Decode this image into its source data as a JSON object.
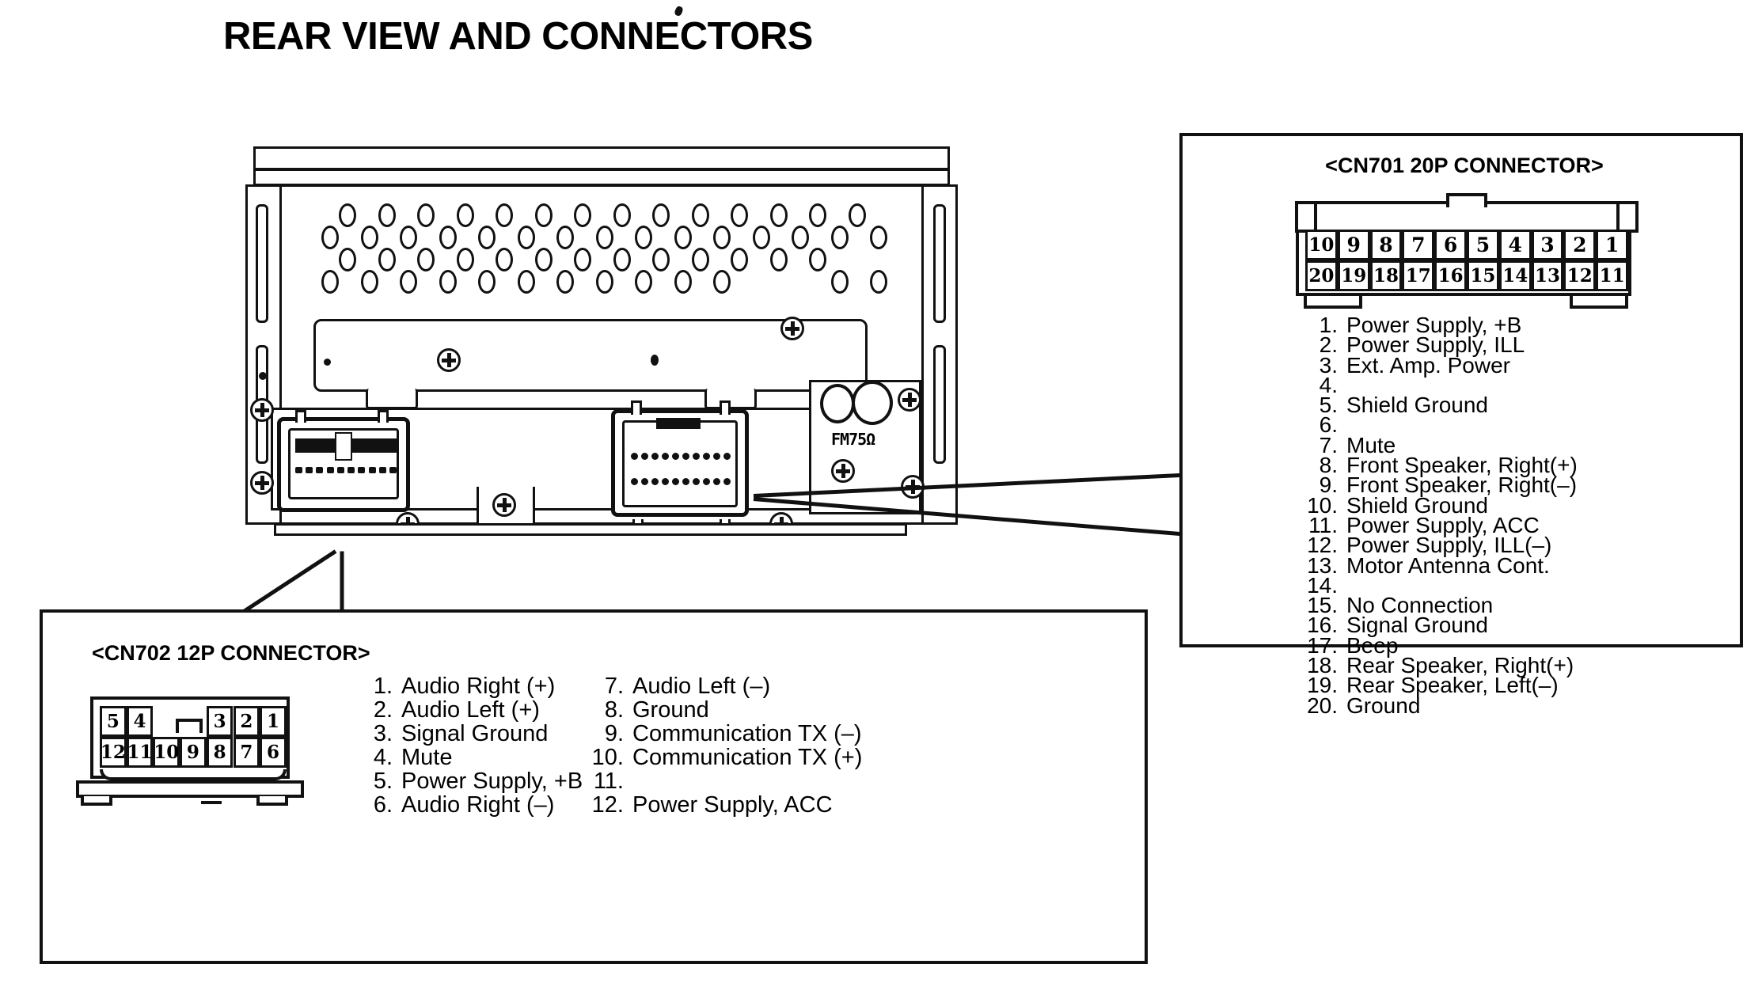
{
  "page": {
    "title": "REAR VIEW AND CONNECTORS"
  },
  "chassis": {
    "antenna_label": "FM75Ω",
    "socket_12p_name": "CN702 12P socket",
    "socket_20p_name": "CN701 20P socket"
  },
  "cn701": {
    "title": "<CN701 20P CONNECTOR>",
    "pin_grid": {
      "top_row": [
        "10",
        "9",
        "8",
        "7",
        "6",
        "5",
        "4",
        "3",
        "2",
        "1"
      ],
      "bottom_row": [
        "20",
        "19",
        "18",
        "17",
        "16",
        "15",
        "14",
        "13",
        "12",
        "11"
      ]
    },
    "pins": [
      {
        "num": "1.",
        "label": "Power Supply, +B"
      },
      {
        "num": "2.",
        "label": "Power Supply, ILL"
      },
      {
        "num": "3.",
        "label": "Ext. Amp. Power"
      },
      {
        "num": "4.",
        "label": ""
      },
      {
        "num": "5.",
        "label": "Shield Ground"
      },
      {
        "num": "6.",
        "label": ""
      },
      {
        "num": "7.",
        "label": "Mute"
      },
      {
        "num": "8.",
        "label": "Front Speaker, Right(+)"
      },
      {
        "num": "9.",
        "label": "Front Speaker, Right(–)"
      },
      {
        "num": "10.",
        "label": "Shield Ground"
      },
      {
        "num": "11.",
        "label": "Power Supply, ACC"
      },
      {
        "num": "12.",
        "label": "Power Supply, ILL(–)"
      },
      {
        "num": "13.",
        "label": "Motor Antenna Cont."
      },
      {
        "num": "14.",
        "label": ""
      },
      {
        "num": "15.",
        "label": "No Connection"
      },
      {
        "num": "16.",
        "label": "Signal Ground"
      },
      {
        "num": "17.",
        "label": "Beep"
      },
      {
        "num": "18.",
        "label": "Rear Speaker, Right(+)"
      },
      {
        "num": "19.",
        "label": "Rear Speaker, Left(–)"
      },
      {
        "num": "20.",
        "label": "Ground"
      }
    ]
  },
  "cn702": {
    "title": "<CN702 12P CONNECTOR>",
    "pin_grid": {
      "top_row": [
        "5",
        "4",
        "",
        "",
        "3",
        "2",
        "1"
      ],
      "bottom_row": [
        "12",
        "11",
        "10",
        "9",
        "8",
        "7",
        "6"
      ]
    },
    "pins_left": [
      {
        "num": "1.",
        "label": "Audio Right (+)"
      },
      {
        "num": "2.",
        "label": "Audio Left (+)"
      },
      {
        "num": "3.",
        "label": "Signal Ground"
      },
      {
        "num": "4.",
        "label": "Mute"
      },
      {
        "num": "5.",
        "label": "Power Supply, +B"
      },
      {
        "num": "6.",
        "label": "Audio Right (–)"
      }
    ],
    "pins_right": [
      {
        "num": "7.",
        "label": "Audio Left (–)"
      },
      {
        "num": "8.",
        "label": "Ground"
      },
      {
        "num": "9.",
        "label": "Communication TX (–)"
      },
      {
        "num": "10.",
        "label": "Communication TX (+)"
      },
      {
        "num": "11.",
        "label": ""
      },
      {
        "num": "12.",
        "label": "Power Supply, ACC"
      }
    ]
  },
  "colors": {
    "ink": "#111111",
    "paper": "#ffffff"
  }
}
